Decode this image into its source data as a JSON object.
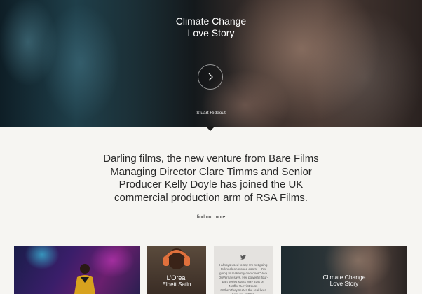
{
  "hero": {
    "title_line1": "Climate Change",
    "title_line2": "Love Story",
    "credit": "Stuart Rideout"
  },
  "intro": {
    "line1": "Darling films, the new venture from Bare Films",
    "line2": "Managing Director Clare Timms and Senior",
    "line3": "Producer Kelly Doyle has joined the UK",
    "line4": "commercial production arm of RSA Films.",
    "link": "find out more"
  },
  "tiles": {
    "t2_line1": "L'Oreal",
    "t2_line2": "Elnett Satin",
    "t3_tweet": "I always used to say I'm not going to knock on closed doors — I'm going to make my own door.\" Ava DuVernay says. Her powerful four-part series starts May 31st on Netflix #LeviStrauss #WhenTheySeeUs the real lives here via @RSA",
    "t4_line1": "Climate Change",
    "t4_line2": "Love Story"
  },
  "colors": {
    "page_bg": "#f6f5f2",
    "notch": "#1d1d1d",
    "twitter": "#5a5a5a"
  },
  "icons": {
    "play": "chevron-right-icon",
    "twitter": "twitter-icon"
  }
}
